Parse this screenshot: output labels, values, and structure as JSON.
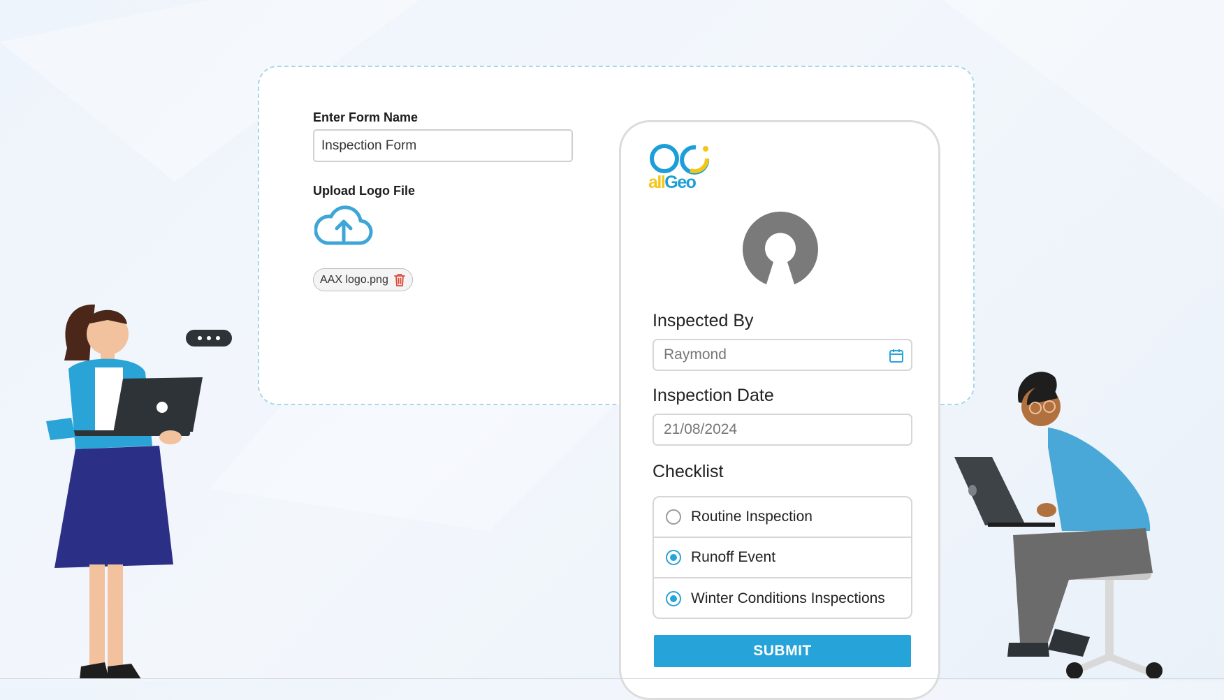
{
  "form_builder": {
    "form_name_label": "Enter Form Name",
    "form_name_value": "Inspection Form",
    "upload_label": "Upload Logo File",
    "uploaded_file": "AAX logo.png"
  },
  "preview": {
    "brand_logo_text": "allGeo",
    "inspected_by_label": "Inspected By",
    "inspected_by_value": "Raymond",
    "inspection_date_label": "Inspection Date",
    "inspection_date_value": "21/08/2024",
    "checklist_label": "Checklist",
    "checklist_items": [
      {
        "label": "Routine Inspection",
        "selected": false
      },
      {
        "label": "Runoff Event",
        "selected": true
      },
      {
        "label": "Winter Conditions Inspections",
        "selected": true
      }
    ],
    "submit_label": "SUBMIT"
  },
  "colors": {
    "accent": "#26a3d8",
    "brand_blue": "#1c9fd8",
    "brand_yellow": "#f5c518",
    "delete_red": "#e0483a"
  },
  "icons": [
    "upload-cloud-icon",
    "trash-icon",
    "calendar-icon",
    "open-source-logo-icon",
    "more-dots-icon"
  ]
}
